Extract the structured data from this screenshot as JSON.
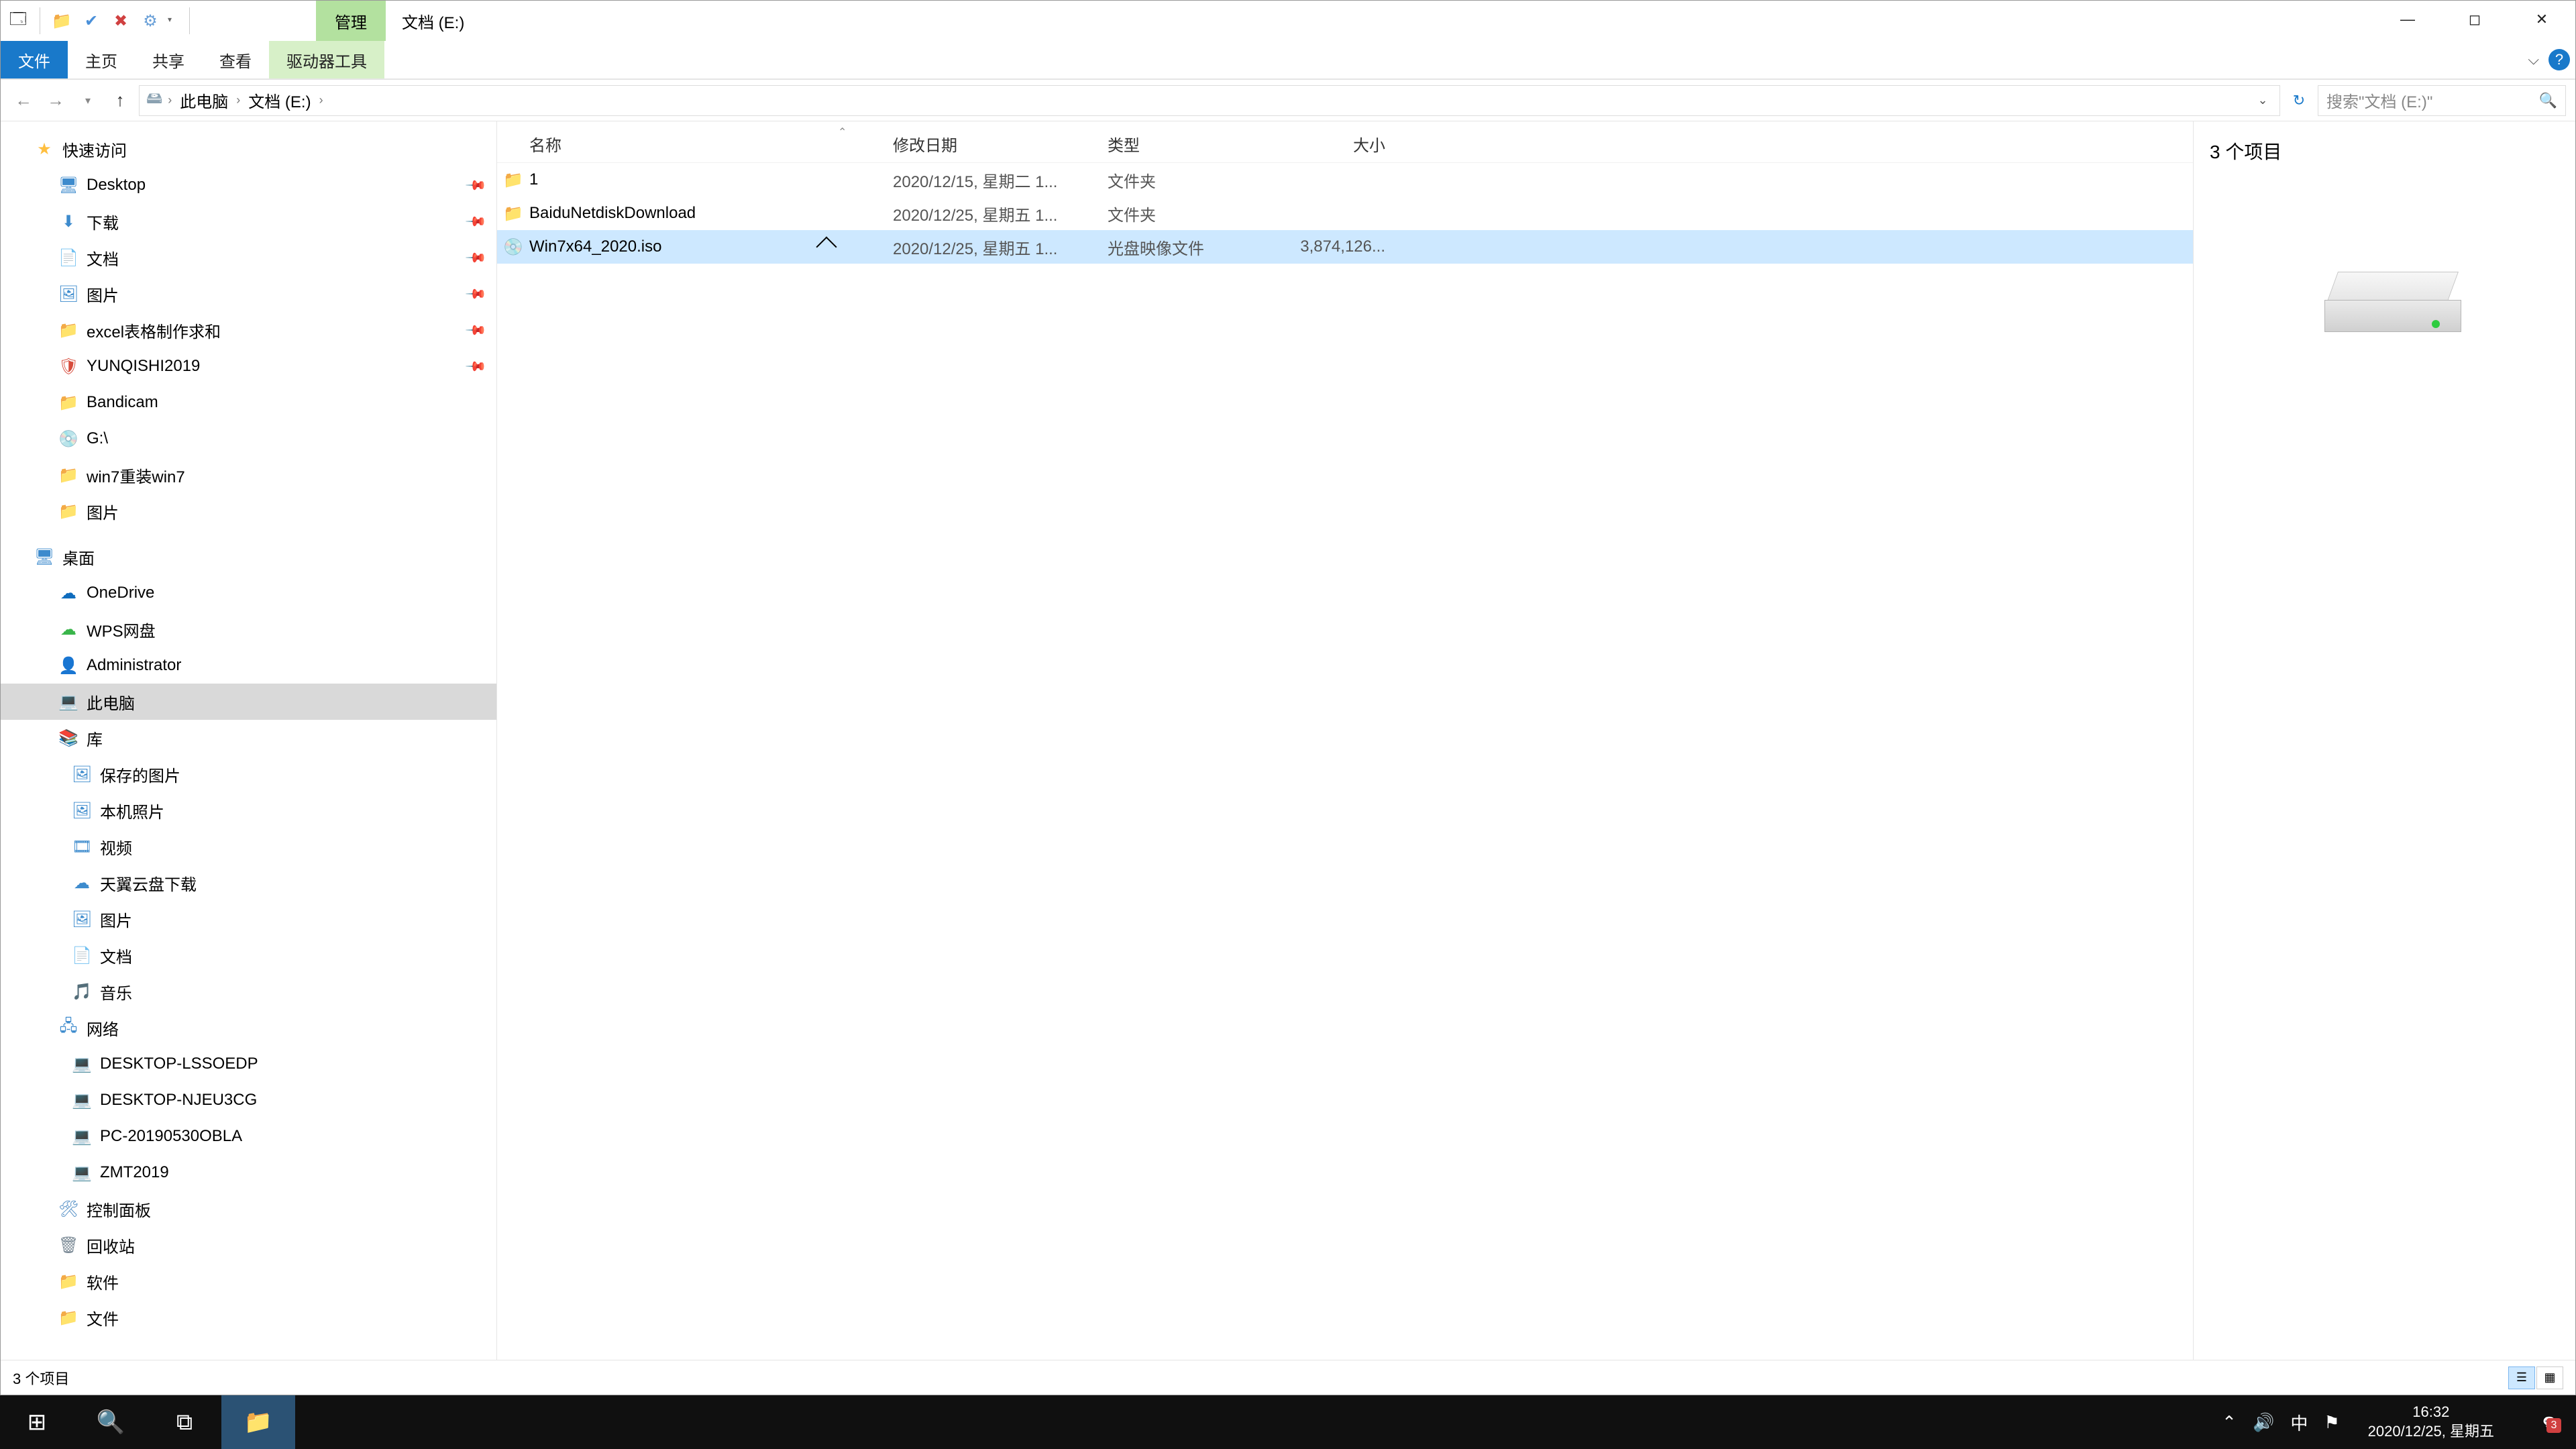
{
  "titlebar": {
    "context_tab": "管理",
    "location_title": "文档 (E:)"
  },
  "ribbon": {
    "file": "文件",
    "home": "主页",
    "share": "共享",
    "view": "查看",
    "drive_tools": "驱动器工具"
  },
  "breadcrumb": {
    "seg1": "此电脑",
    "seg2": "文档 (E:)"
  },
  "search": {
    "placeholder": "搜索\"文档 (E:)\""
  },
  "nav": {
    "quick": "快速访问",
    "desktop": "Desktop",
    "downloads": "下载",
    "documents": "文档",
    "pictures": "图片",
    "excel_template": "excel表格制作求和",
    "yunqishi": "YUNQISHI2019",
    "bandicam": "Bandicam",
    "gdrive": "G:\\",
    "win7reinstall": "win7重装win7",
    "pictures2": "图片",
    "desktop_root": "桌面",
    "onedrive": "OneDrive",
    "wps": "WPS网盘",
    "admin": "Administrator",
    "thispc": "此电脑",
    "libraries": "库",
    "saved_pics": "保存的图片",
    "camera_roll": "本机照片",
    "videos": "视频",
    "tianyi": "天翼云盘下载",
    "pictures_lib": "图片",
    "documents_lib": "文档",
    "music": "音乐",
    "network": "网络",
    "pc1": "DESKTOP-LSSOEDP",
    "pc2": "DESKTOP-NJEU3CG",
    "pc3": "PC-20190530OBLA",
    "pc4": "ZMT2019",
    "control": "控制面板",
    "recycle": "回收站",
    "software": "软件",
    "files": "文件"
  },
  "columns": {
    "name": "名称",
    "date": "修改日期",
    "type": "类型",
    "size": "大小"
  },
  "rows": [
    {
      "name": "1",
      "date": "2020/12/15, 星期二 1...",
      "type": "文件夹",
      "size": "",
      "icon": "folder"
    },
    {
      "name": "BaiduNetdiskDownload",
      "date": "2020/12/25, 星期五 1...",
      "type": "文件夹",
      "size": "",
      "icon": "folder"
    },
    {
      "name": "Win7x64_2020.iso",
      "date": "2020/12/25, 星期五 1...",
      "type": "光盘映像文件",
      "size": "3,874,126...",
      "icon": "iso"
    }
  ],
  "preview": {
    "count": "3 个项目"
  },
  "status": {
    "left": "3 个项目"
  },
  "clock": {
    "time": "16:32",
    "date": "2020/12/25, 星期五"
  }
}
